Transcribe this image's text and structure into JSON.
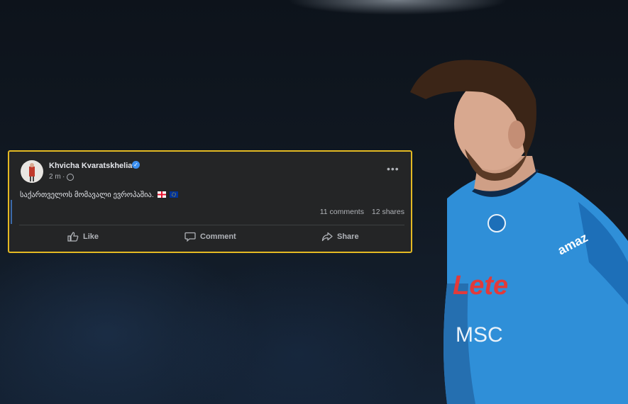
{
  "post": {
    "author": "Khvicha Kvaratskhelia",
    "time": "2 m",
    "text": "საქართველოს მომავალი ევროპაშია.",
    "comments": "11 comments",
    "shares": "12 shares",
    "actions": {
      "like": "Like",
      "comment": "Comment",
      "share": "Share"
    }
  },
  "background": {
    "shirt_text_1": "Lete",
    "shirt_text_2": "MSC",
    "sleeve_text": "amaz",
    "colors": {
      "shirt": "#2f8fd8",
      "border": "#e3b923",
      "card": "#242526"
    }
  }
}
